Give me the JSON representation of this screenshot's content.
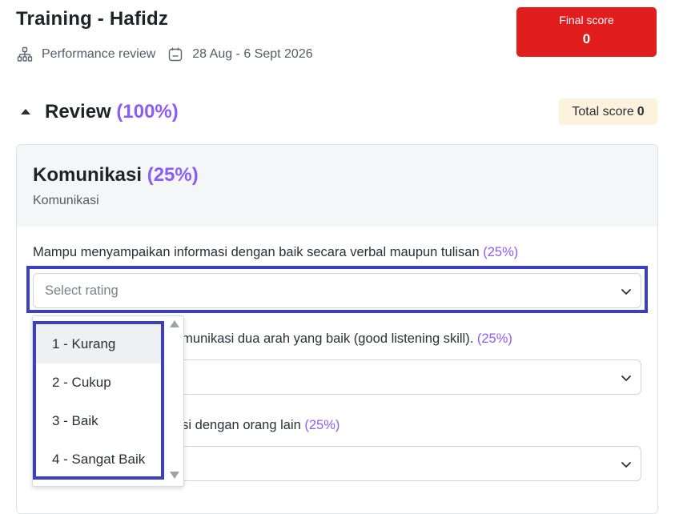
{
  "header": {
    "title": "Training - Hafidz",
    "type_label": "Performance review",
    "date_range": "28 Aug - 6 Sept 2026",
    "final_score_label": "Final score",
    "final_score_value": "0"
  },
  "review": {
    "title": "Review",
    "percent": "(100%)",
    "total_score_label": "Total score",
    "total_score_value": "0"
  },
  "section": {
    "title": "Komunikasi",
    "percent": "(25%)",
    "subtitle": "Komunikasi",
    "questions": [
      {
        "text": "Mampu menyampaikan informasi dengan baik secara verbal maupun tulisan",
        "percent": "(25%)",
        "placeholder": "Select rating"
      },
      {
        "text": "omunikasi dua arah yang baik (good listening skill).",
        "percent": "(25%)"
      },
      {
        "text": "asi dengan orang lain",
        "percent": "(25%)"
      }
    ]
  },
  "dropdown": {
    "options": [
      "1 - Kurang",
      "2 - Cukup",
      "3 - Baik",
      "4 - Sangat Baik"
    ],
    "highlighted_index": 0
  },
  "colors": {
    "accent_purple": "#8b5cf6",
    "final_score_bg": "#e11d1d",
    "highlight_border": "#3b3fc4",
    "total_pill_bg": "#fdf3dd"
  },
  "icons": [
    "org-chart-icon",
    "calendar-icon",
    "chevron-down-icon",
    "caret-up-icon"
  ]
}
